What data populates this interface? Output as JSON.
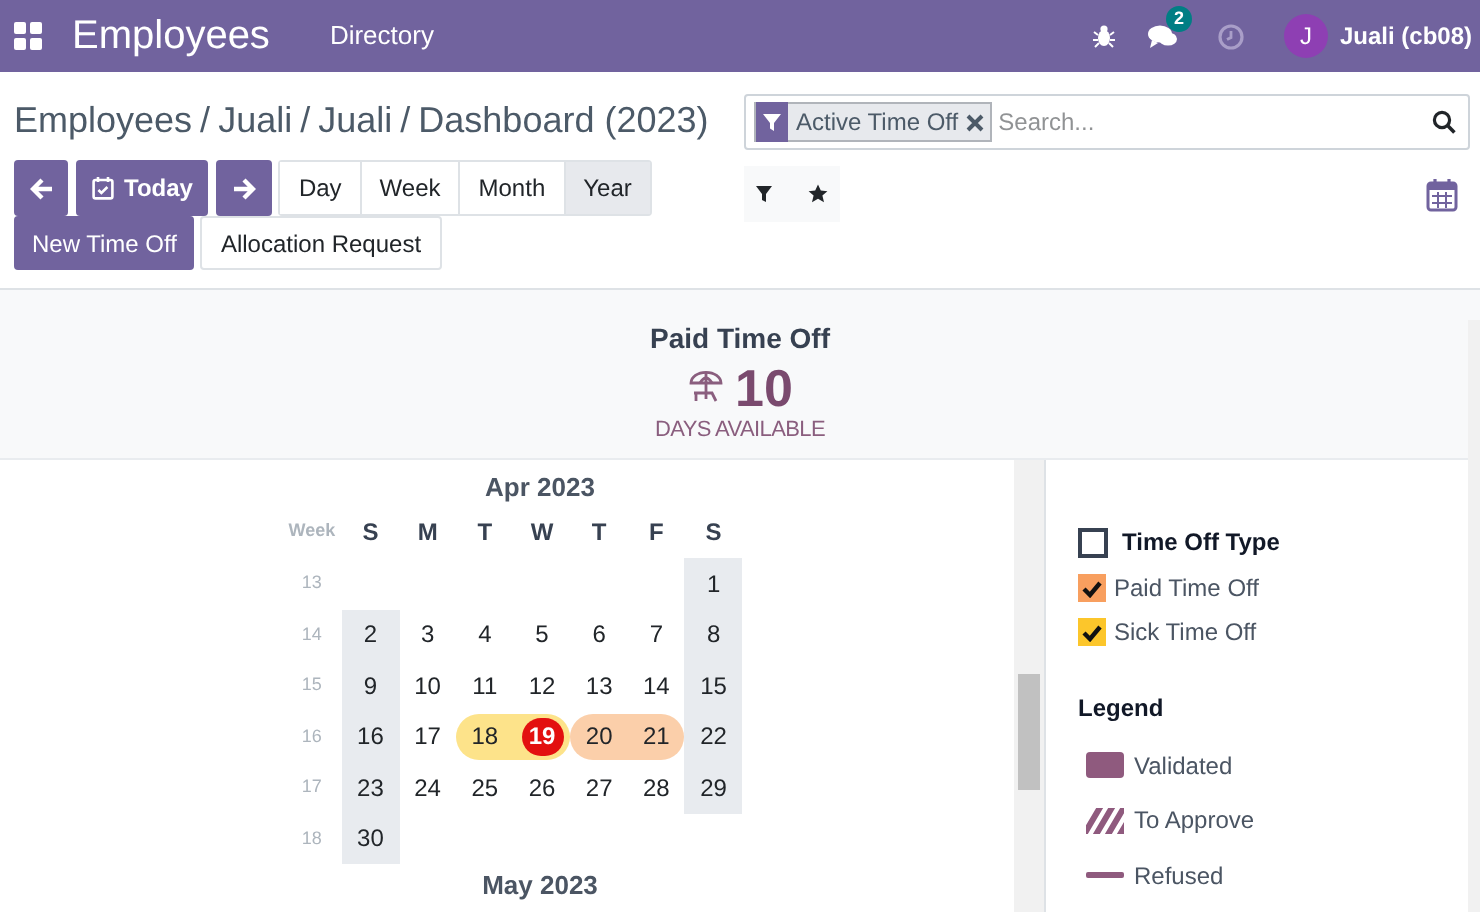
{
  "navbar": {
    "app_title": "Employees",
    "menu": [
      "Directory"
    ],
    "messages_badge": "2",
    "user_initial": "J",
    "user_name": "Juali (cb08)"
  },
  "breadcrumb": {
    "separator": "/",
    "items": [
      "Employees",
      "Juali",
      "Juali",
      "Dashboard (2023)"
    ]
  },
  "search": {
    "facet": "Active Time Off",
    "placeholder": "Search..."
  },
  "controls": {
    "today": "Today",
    "scales": [
      {
        "label": "Day",
        "selected": false
      },
      {
        "label": "Week",
        "selected": false
      },
      {
        "label": "Month",
        "selected": false
      },
      {
        "label": "Year",
        "selected": true
      }
    ],
    "actions": [
      "New Time Off",
      "Allocation Request"
    ]
  },
  "summary": {
    "title": "Paid Time Off",
    "count": "10",
    "caption": "DAYS AVAILABLE"
  },
  "calendar": {
    "month": "Apr 2023",
    "week_header": "Week",
    "weekdays": [
      "S",
      "M",
      "T",
      "W",
      "T",
      "F",
      "S"
    ],
    "weeks": [
      {
        "number": "13",
        "days": [
          {
            "kind": "empty"
          },
          {
            "kind": "empty"
          },
          {
            "kind": "empty"
          },
          {
            "kind": "empty"
          },
          {
            "kind": "empty"
          },
          {
            "kind": "empty"
          },
          {
            "text": "1"
          }
        ]
      },
      {
        "number": "14",
        "days": [
          {
            "text": "2"
          },
          {
            "text": "3"
          },
          {
            "text": "4"
          },
          {
            "text": "5"
          },
          {
            "text": "6"
          },
          {
            "text": "7"
          },
          {
            "text": "8"
          }
        ]
      },
      {
        "number": "15",
        "days": [
          {
            "text": "9"
          },
          {
            "text": "10"
          },
          {
            "text": "11"
          },
          {
            "text": "12"
          },
          {
            "text": "13"
          },
          {
            "text": "14"
          },
          {
            "text": "15"
          }
        ]
      },
      {
        "number": "16",
        "days": [
          {
            "text": "16"
          },
          {
            "text": "17"
          },
          {
            "text": "18",
            "kind": "sick_leave"
          },
          {
            "text": "19",
            "kind": "sick_leave",
            "today": true
          },
          {
            "text": "20",
            "kind": "paid_leave"
          },
          {
            "text": "21",
            "kind": "paid_leave"
          },
          {
            "text": "22"
          }
        ]
      },
      {
        "number": "17",
        "days": [
          {
            "text": "23"
          },
          {
            "text": "24"
          },
          {
            "text": "25"
          },
          {
            "text": "26"
          },
          {
            "text": "27"
          },
          {
            "text": "28"
          },
          {
            "text": "29"
          }
        ]
      },
      {
        "number": "18",
        "days": [
          {
            "text": "30"
          },
          {
            "kind": "empty"
          },
          {
            "kind": "empty"
          },
          {
            "kind": "empty"
          },
          {
            "kind": "empty"
          },
          {
            "kind": "empty"
          },
          {
            "kind": "empty"
          }
        ]
      }
    ],
    "next_month": "May 2023"
  },
  "sidebar": {
    "filters": [
      {
        "label": "Time Off Type",
        "checked": false,
        "kind": "header"
      },
      {
        "label": "Paid Time Off",
        "checked": true,
        "kind": "type",
        "color": "#f89f5f"
      },
      {
        "label": "Sick Time Off",
        "checked": true,
        "kind": "type",
        "color": "#fcc62b"
      }
    ],
    "legend_title": "Legend",
    "legend": [
      {
        "label": "Validated",
        "kind": "validated"
      },
      {
        "label": "To Approve",
        "kind": "to_approve"
      },
      {
        "label": "Refused",
        "kind": "refused"
      }
    ]
  }
}
